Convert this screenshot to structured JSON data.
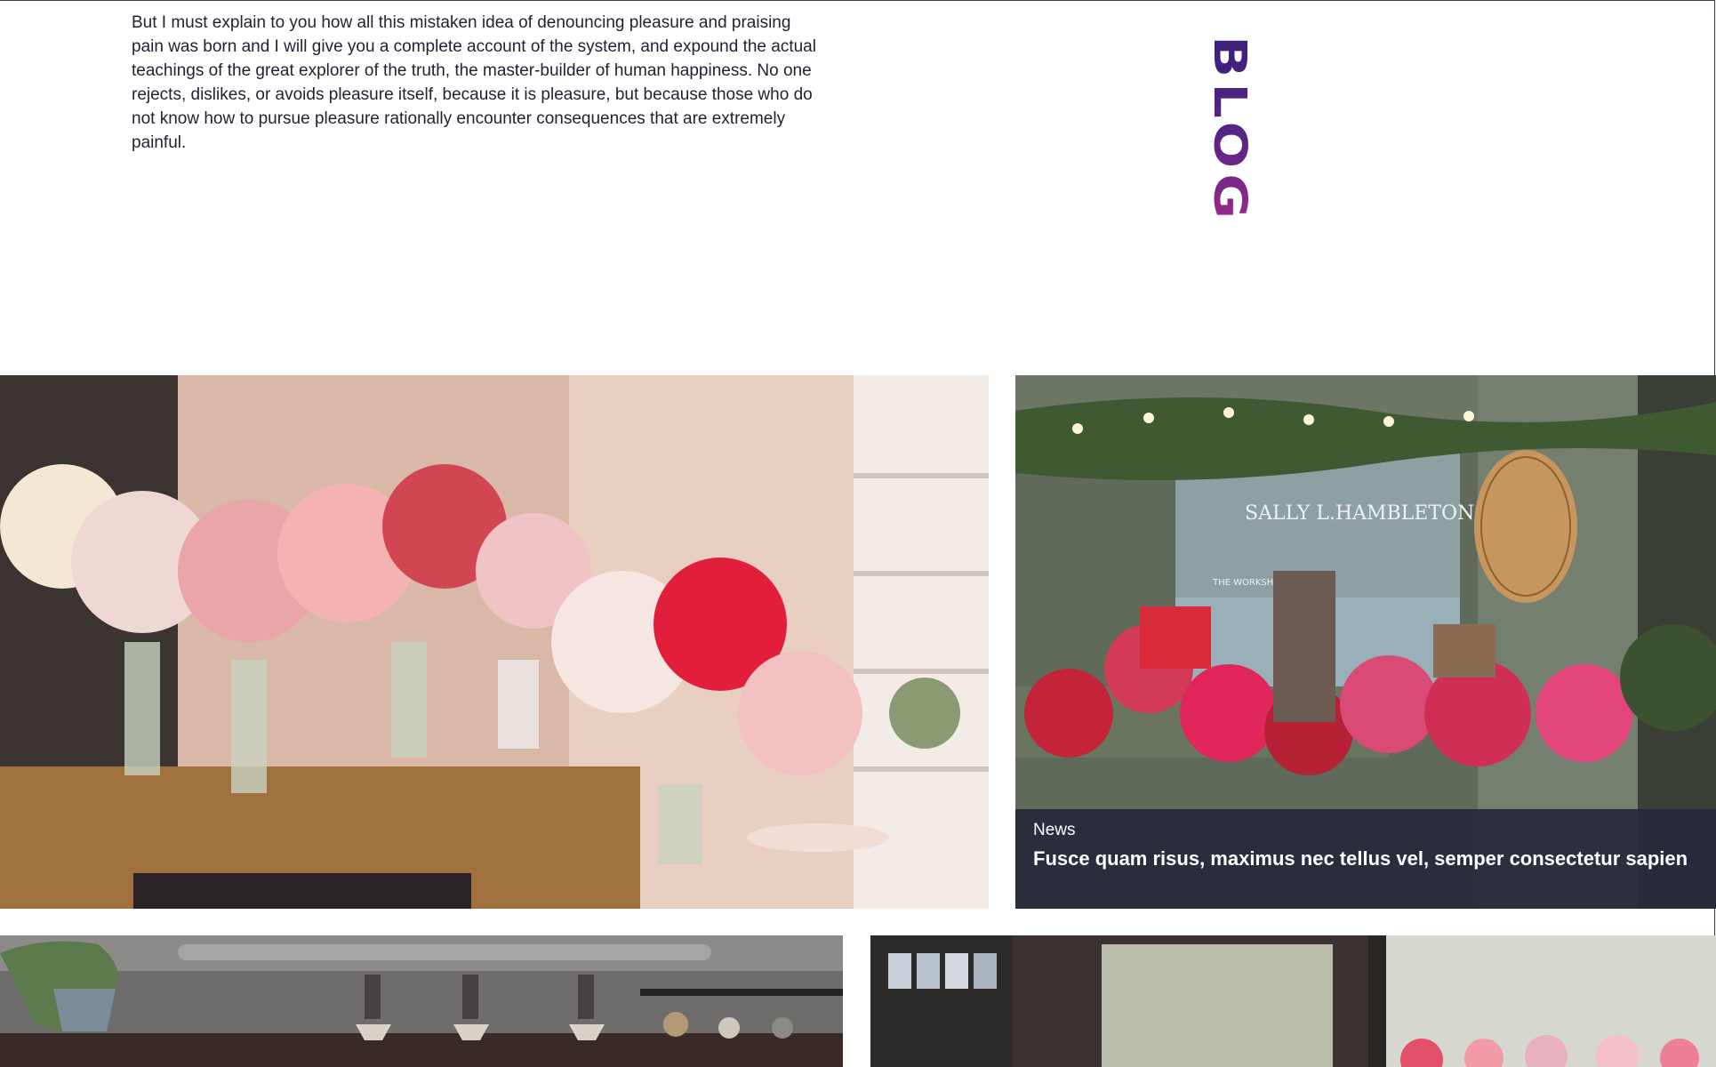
{
  "intro": {
    "text": "But I must explain to you how all this mistaken idea of denouncing pleasure and praising pain was born and I will give you a complete account of the system, and expound the actual teachings of the great explorer of the truth, the master-builder of human happiness. No one rejects, dislikes, or avoids pleasure itself, because it is pleasure, but because those who do not know how to pursue pleasure rationally encounter consequences that are extremely painful."
  },
  "heading": {
    "label": "BLOG"
  },
  "posts": [
    {
      "image": "flower-shop-interior-photo",
      "category": "",
      "title": ""
    },
    {
      "image": "flower-shop-storefront-photo",
      "category": "News",
      "title": "Fusce quam risus, maximus nec tellus vel, semper consectetur sapien",
      "storefront_sign": "SALLY L.HAMBLETON",
      "storefront_sign_sub": "THE WORKSHOP FLO CO."
    },
    {
      "image": "cafe-interior-photo",
      "category": "",
      "title": ""
    },
    {
      "image": "florist-window-photo",
      "category": "",
      "title": ""
    }
  ],
  "colors": {
    "heading_gradient_top": "#3a1f7a",
    "heading_gradient_bottom": "#9a2a8c",
    "caption_background": "#262838",
    "body_text": "#1f2230"
  }
}
